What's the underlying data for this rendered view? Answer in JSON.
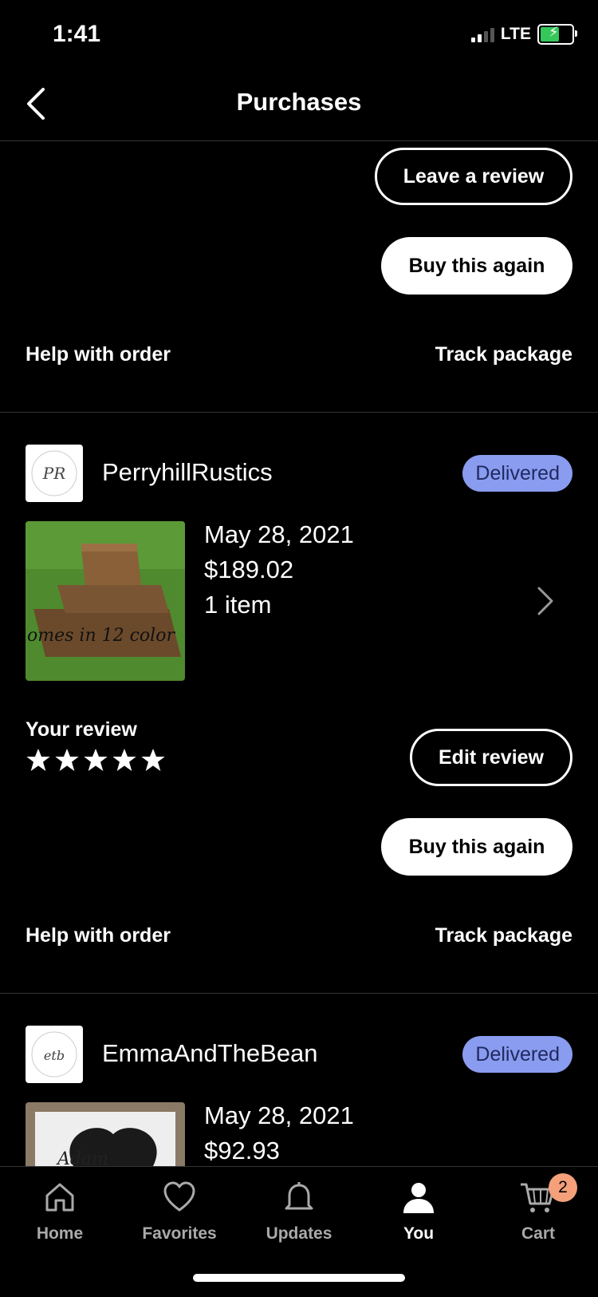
{
  "status_bar": {
    "time": "1:41",
    "network": "LTE"
  },
  "header": {
    "title": "Purchases"
  },
  "top_section": {
    "leave_review_label": "Leave a review",
    "buy_again_label": "Buy this again",
    "help_label": "Help with order",
    "track_label": "Track package"
  },
  "orders": [
    {
      "shop_name": "PerryhillRustics",
      "shop_logo_text": "PR",
      "status": "Delivered",
      "date": "May 28, 2021",
      "price": "$189.02",
      "items": "1 item",
      "thumb_caption": "omes in 12 color",
      "review_label": "Your review",
      "review_rating": 5,
      "edit_review_label": "Edit review",
      "buy_again_label": "Buy this again",
      "help_label": "Help with order",
      "track_label": "Track package"
    },
    {
      "shop_name": "EmmaAndTheBean",
      "shop_logo_text": "etb",
      "status": "Delivered",
      "date": "May 28, 2021",
      "price": "$92.93",
      "thumb_caption": "Adam"
    }
  ],
  "tab_bar": {
    "tabs": [
      {
        "label": "Home"
      },
      {
        "label": "Favorites"
      },
      {
        "label": "Updates"
      },
      {
        "label": "You"
      },
      {
        "label": "Cart"
      }
    ],
    "active": "You",
    "cart_count": "2"
  }
}
